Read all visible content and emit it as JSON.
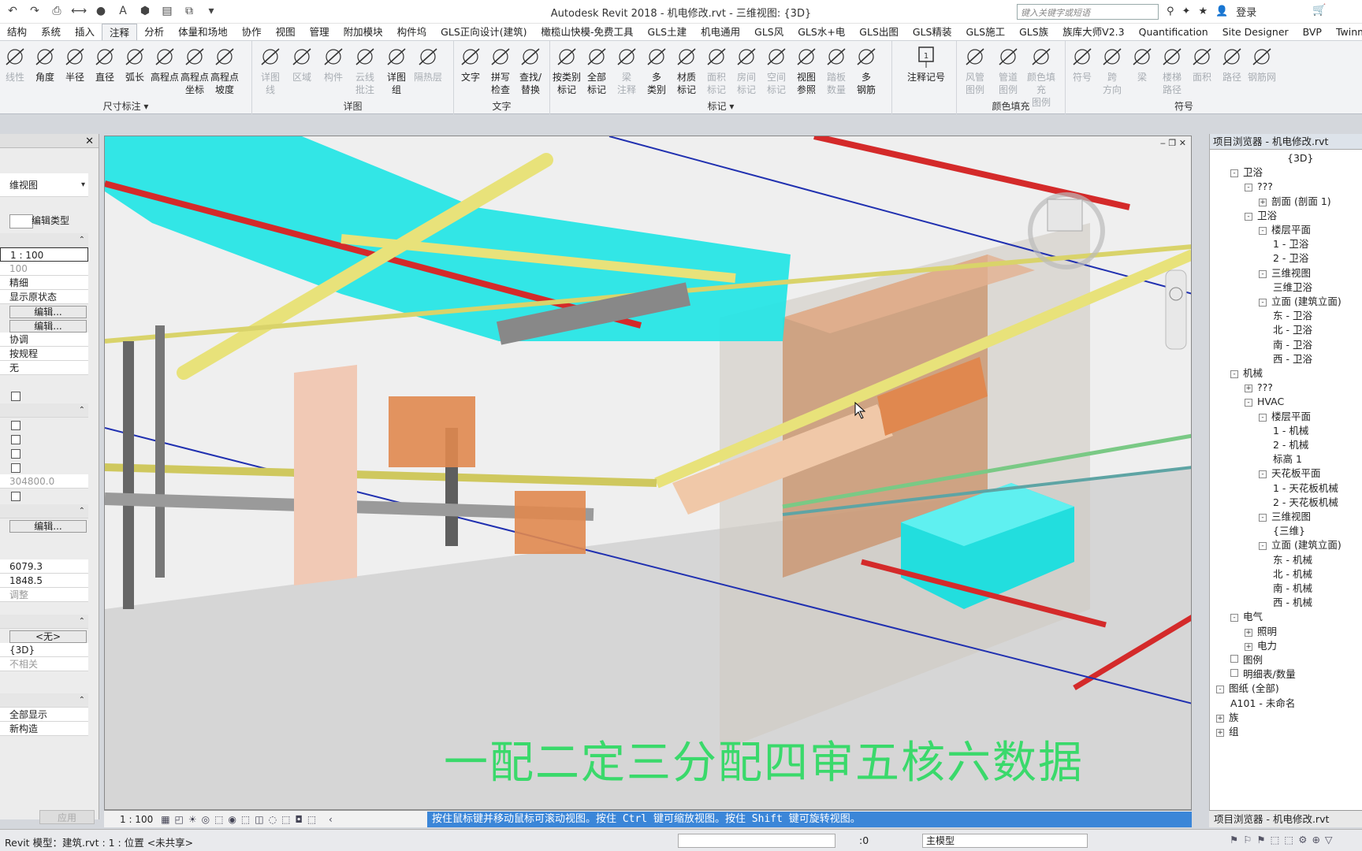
{
  "title": {
    "app": "Autodesk Revit 2018 -",
    "document": "机电修改.rvt - 三维视图: {3D}",
    "search_placeholder": "键入关键字或短语",
    "login": "登录"
  },
  "tabs": [
    "结构",
    "系统",
    "插入",
    "注释",
    "分析",
    "体量和场地",
    "协作",
    "视图",
    "管理",
    "附加模块",
    "构件坞",
    "GLS正向设计(建筑)",
    "橄榄山快模-免费工具",
    "GLS土建",
    "机电通用",
    "GLS风",
    "GLS水+电",
    "GLS出图",
    "GLS精装",
    "GLS施工",
    "GLS族",
    "族库大师V2.3",
    "Quantification",
    "Site Designer",
    "BVP",
    "Twinmotion"
  ],
  "active_tab": "注释",
  "ribbon": {
    "dimension_buttons": [
      "线性",
      "角度",
      "半径",
      "直径",
      "弧长",
      "高程点",
      "高程点\n坐标",
      "高程点\n坡度"
    ],
    "dimension_label": "尺寸标注 ▾",
    "detail_buttons": [
      "详图\n线",
      "区域",
      "构件",
      "云线\n批注",
      "详图\n组",
      "隔热层"
    ],
    "detail_label": "详图",
    "text_buttons": [
      "文字",
      "拼写\n检查",
      "查找/\n替换"
    ],
    "text_label": "文字",
    "tag_buttons": [
      "按类别\n标记",
      "全部\n标记",
      "梁\n注释",
      "多\n类别",
      "材质\n标记",
      "面积\n标记",
      "房间\n标记",
      "空间\n标记",
      "视图\n参照",
      "踏板\n数量",
      "多\n钢筋"
    ],
    "tag_label": "标记 ▾",
    "symbol_single": "注释记号",
    "fill_buttons": [
      "风管\n图例",
      "管道\n图例",
      "颜色填充\n图例"
    ],
    "fill_label": "颜色填充",
    "symbol_buttons": [
      "符号",
      "跨\n方向",
      "梁",
      "楼梯\n路径",
      "面积",
      "路径",
      "钢筋网"
    ],
    "symbol_label": "符号"
  },
  "properties": {
    "type_label": "维视图",
    "edit_type": "编辑类型",
    "scale_value": "1 : 100",
    "scale_num": "100",
    "detail_level": "精细",
    "show_original": "显示原状态",
    "edit1": "编辑...",
    "edit2": "编辑...",
    "discipline": "协调",
    "color_scheme": "按规程",
    "none": "无",
    "far_value": "304800.0",
    "edit3": "编辑...",
    "eye_elev": "6079.3",
    "target_elev": "1848.5",
    "adjust": "调整",
    "none_btn": "<无>",
    "view_name": "{3D}",
    "dependency": "不相关",
    "phase_filter": "全部显示",
    "phase": "新构造",
    "apply": "应用"
  },
  "viewport": {
    "subtitle": "一配二定三分配四审五核六数据",
    "scale": "1 : 100",
    "hint": "按住鼠标键并移动鼠标可滚动视图。按住 Ctrl 键可缩放视图。按住 Shift 键可旋转视图。"
  },
  "browser": {
    "header": "项目浏览器 - 机电修改.rvt",
    "footer_tab": "项目浏览器 - 机电修改.rvt",
    "nodes": [
      {
        "t": "{3D}",
        "l": 5,
        "tog": ""
      },
      {
        "t": "卫浴",
        "l": 1,
        "tog": "-"
      },
      {
        "t": "???",
        "l": 2,
        "tog": "-"
      },
      {
        "t": "剖面 (剖面 1)",
        "l": 3,
        "tog": "+"
      },
      {
        "t": "卫浴",
        "l": 2,
        "tog": "-"
      },
      {
        "t": "楼层平面",
        "l": 3,
        "tog": "-"
      },
      {
        "t": "1 - 卫浴",
        "l": 4,
        "tog": ""
      },
      {
        "t": "2 - 卫浴",
        "l": 4,
        "tog": ""
      },
      {
        "t": "三维视图",
        "l": 3,
        "tog": "-"
      },
      {
        "t": "三维卫浴",
        "l": 4,
        "tog": ""
      },
      {
        "t": "立面 (建筑立面)",
        "l": 3,
        "tog": "-"
      },
      {
        "t": "东 - 卫浴",
        "l": 4,
        "tog": ""
      },
      {
        "t": "北 - 卫浴",
        "l": 4,
        "tog": ""
      },
      {
        "t": "南 - 卫浴",
        "l": 4,
        "tog": ""
      },
      {
        "t": "西 - 卫浴",
        "l": 4,
        "tog": ""
      },
      {
        "t": "机械",
        "l": 1,
        "tog": "-"
      },
      {
        "t": "???",
        "l": 2,
        "tog": "+"
      },
      {
        "t": "HVAC",
        "l": 2,
        "tog": "-"
      },
      {
        "t": "楼层平面",
        "l": 3,
        "tog": "-"
      },
      {
        "t": "1 - 机械",
        "l": 4,
        "tog": ""
      },
      {
        "t": "2 - 机械",
        "l": 4,
        "tog": ""
      },
      {
        "t": "标高 1",
        "l": 4,
        "tog": ""
      },
      {
        "t": "天花板平面",
        "l": 3,
        "tog": "-"
      },
      {
        "t": "1 - 天花板机械",
        "l": 4,
        "tog": ""
      },
      {
        "t": "2 - 天花板机械",
        "l": 4,
        "tog": ""
      },
      {
        "t": "三维视图",
        "l": 3,
        "tog": "-"
      },
      {
        "t": "{三维}",
        "l": 4,
        "tog": ""
      },
      {
        "t": "立面 (建筑立面)",
        "l": 3,
        "tog": "-"
      },
      {
        "t": "东 - 机械",
        "l": 4,
        "tog": ""
      },
      {
        "t": "北 - 机械",
        "l": 4,
        "tog": ""
      },
      {
        "t": "南 - 机械",
        "l": 4,
        "tog": ""
      },
      {
        "t": "西 - 机械",
        "l": 4,
        "tog": ""
      },
      {
        "t": "电气",
        "l": 1,
        "tog": "-"
      },
      {
        "t": "照明",
        "l": 2,
        "tog": "+"
      },
      {
        "t": "电力",
        "l": 2,
        "tog": "+"
      },
      {
        "t": "图例",
        "l": 1,
        "tog": "□"
      },
      {
        "t": "明细表/数量",
        "l": 1,
        "tog": "□"
      },
      {
        "t": "图纸 (全部)",
        "l": 0,
        "tog": "-"
      },
      {
        "t": "A101 - 未命名",
        "l": 1,
        "tog": ""
      },
      {
        "t": "族",
        "l": 0,
        "tog": "+"
      },
      {
        "t": "组",
        "l": 0,
        "tog": "+"
      }
    ]
  },
  "status": {
    "text": "Revit 模型：建筑.rvt : 1 : 位置 <未共享>",
    "zero": ":0",
    "model": "主模型"
  },
  "colors": {
    "accent": "#3b86d8",
    "subtitle": "#3ad96b",
    "cyan_duct": "#22e5e5",
    "yellow_pipe": "#e8e27a",
    "red_pipe": "#d42a2a",
    "copper": "#e0884f"
  }
}
